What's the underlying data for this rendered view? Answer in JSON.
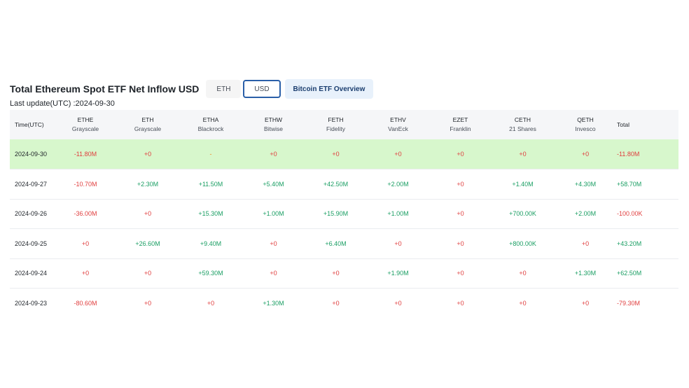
{
  "header": {
    "title": "Total Ethereum Spot ETF Net Inflow USD",
    "toggle_eth": "ETH",
    "toggle_usd": "USD",
    "overview_button": "Bitcoin ETF Overview",
    "last_update": "Last update(UTC) :2024-09-30"
  },
  "columns": [
    {
      "ticker": "Time(UTC)",
      "issuer": ""
    },
    {
      "ticker": "ETHE",
      "issuer": "Grayscale"
    },
    {
      "ticker": "ETH",
      "issuer": "Grayscale"
    },
    {
      "ticker": "ETHA",
      "issuer": "Blackrock"
    },
    {
      "ticker": "ETHW",
      "issuer": "Bitwise"
    },
    {
      "ticker": "FETH",
      "issuer": "Fidelity"
    },
    {
      "ticker": "ETHV",
      "issuer": "VanEck"
    },
    {
      "ticker": "EZET",
      "issuer": "Franklin"
    },
    {
      "ticker": "CETH",
      "issuer": "21 Shares"
    },
    {
      "ticker": "QETH",
      "issuer": "Invesco"
    },
    {
      "ticker": "Total",
      "issuer": ""
    }
  ],
  "rows": [
    {
      "date": "2024-09-30",
      "values": [
        "-11.80M",
        "+0",
        "-",
        "+0",
        "+0",
        "+0",
        "+0",
        "+0",
        "+0",
        "-11.80M"
      ]
    },
    {
      "date": "2024-09-27",
      "values": [
        "-10.70M",
        "+2.30M",
        "+11.50M",
        "+5.40M",
        "+42.50M",
        "+2.00M",
        "+0",
        "+1.40M",
        "+4.30M",
        "+58.70M"
      ]
    },
    {
      "date": "2024-09-26",
      "values": [
        "-36.00M",
        "+0",
        "+15.30M",
        "+1.00M",
        "+15.90M",
        "+1.00M",
        "+0",
        "+700.00K",
        "+2.00M",
        "-100.00K"
      ]
    },
    {
      "date": "2024-09-25",
      "values": [
        "+0",
        "+26.60M",
        "+9.40M",
        "+0",
        "+6.40M",
        "+0",
        "+0",
        "+800.00K",
        "+0",
        "+43.20M"
      ]
    },
    {
      "date": "2024-09-24",
      "values": [
        "+0",
        "+0",
        "+59.30M",
        "+0",
        "+0",
        "+1.90M",
        "+0",
        "+0",
        "+1.30M",
        "+62.50M"
      ]
    },
    {
      "date": "2024-09-23",
      "values": [
        "-80.60M",
        "+0",
        "+0",
        "+1.30M",
        "+0",
        "+0",
        "+0",
        "+0",
        "+0",
        "-79.30M"
      ]
    }
  ],
  "colors": {
    "positive": "#1a9e63",
    "negative": "#e03e3e",
    "zero": "#e03e3e",
    "dash": "#f08a24",
    "highlight_row": "#d7f7cc"
  }
}
